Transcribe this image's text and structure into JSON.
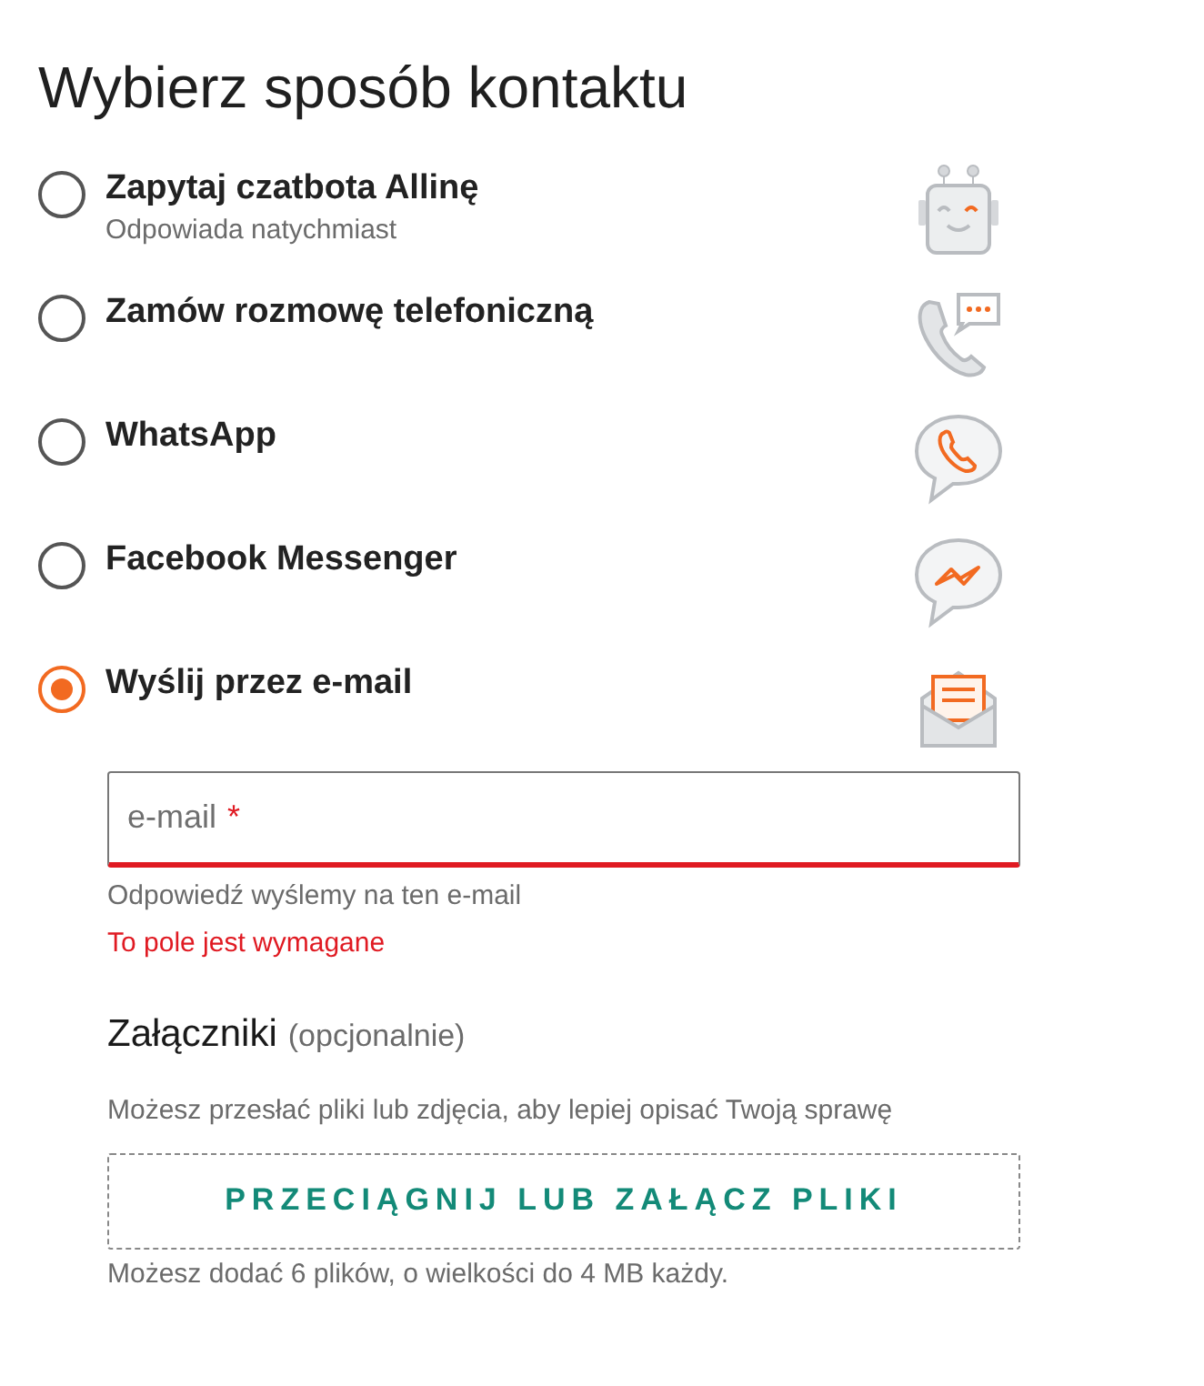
{
  "title": "Wybierz sposób kontaktu",
  "options": [
    {
      "label": "Zapytaj czatbota Allinę",
      "sublabel": "Odpowiada natychmiast",
      "kind": "robot",
      "selected": false
    },
    {
      "label": "Zamów rozmowę telefoniczną",
      "kind": "phone",
      "selected": false
    },
    {
      "label": "WhatsApp",
      "kind": "whatsapp",
      "selected": false
    },
    {
      "label": "Facebook Messenger",
      "kind": "messenger",
      "selected": false
    },
    {
      "label": "Wyślij przez e-mail",
      "kind": "email",
      "selected": true
    }
  ],
  "email_field": {
    "placeholder": "e-mail",
    "required_mark": "*",
    "invalid": true,
    "hint": "Odpowiedź wyślemy na ten e-mail",
    "error": "To pole jest wymagane"
  },
  "attachments": {
    "title": "Załączniki",
    "title_note": "(opcjonalnie)",
    "description": "Możesz przesłać pliki lub zdjęcia, aby lepiej opisać Twoją sprawę",
    "drop_zone": "PRZECIĄGNIJ LUB ZAŁĄCZ PLIKI",
    "limit": "Możesz dodać 6 plików, o wielkości do 4 MB każdy."
  }
}
